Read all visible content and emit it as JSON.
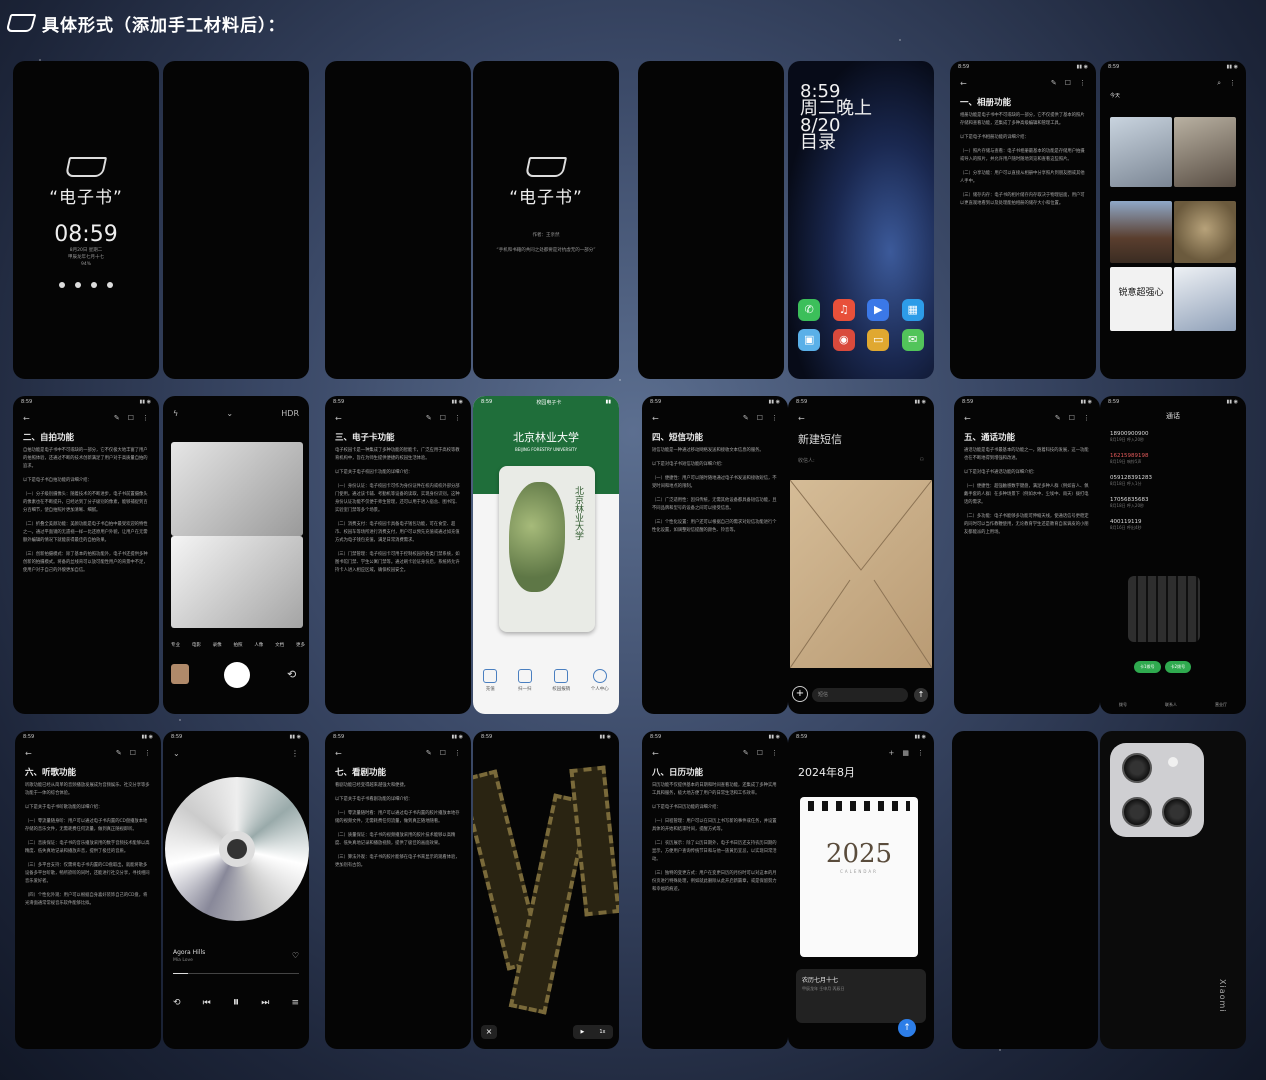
{
  "header": {
    "title": "具体形式（添加手工材料后）："
  },
  "lockscreen": {
    "cover_title": "“电子书”",
    "time": "08:59",
    "date_line1": "8月20日 星期二",
    "date_line2": "甲辰龙年七月十七",
    "battery": "94%"
  },
  "cover2": {
    "cover_title": "“电子书”",
    "author": "作者：王亲然",
    "quote": "“手机和书籍的共同之处都要是对抗虚无的一部分”"
  },
  "home": {
    "time_lines": [
      "8:59",
      "周二晚上",
      "8/20",
      "目录"
    ]
  },
  "status_time": "8:59",
  "album": {
    "title": "一、相册功能",
    "intro": "相册功能是电子书中不可或缺的一部分，它不仅提供了基本的照片存储和查看功能，还集成了多种高级编辑和管理工具。",
    "lead": "以下是电子书相册功能的详细介绍：",
    "p1": "（一）照片存储与查看：电子书相册最基本的功能是存储用户拍摄或导入的照片，并允许用户随时随地浏览和查看这些照片。",
    "p2": "（二）分享功能：用户可以直接从相册中分享照片到朋友圈或其他人手中。",
    "p3": "（三）储存内存：电子书的相片储存内存取决于物理层面，用户可以更直观地看到以及处理能拍相册的储存大小和位置。",
    "today": "今天",
    "sign_text": "锐意超强心"
  },
  "camera": {
    "title": "二、自拍功能",
    "intro": "自拍功能是电子书中不可或缺的一部分，它不仅极大地丰富了用户的拍照体验，还通过不断的技术创新满足了用户对于高质量自拍的追求。",
    "lead": "以下是电子书自拍功能的详细介绍：",
    "p1": "（一）分子级别摄像头：随着技术的不断进步，电子书前置摄像头的像素也在不断提升，已经达到了分子级别的像素，能够捕捉到百分百细节，使自拍照片更加清晰、细腻。",
    "p2": "（二）折叠全美颜功能：美颜功能是电子书自拍中最受欢迎的特性之一。通过平面镜的无遗视一样一比还原用户外貌，让用户在无需额外编辑的情况下就能获得最佳的自拍效果。",
    "p3": "（三）创新拍摄模式：除了基本的拍照功能外，电子书还提供多种创新的拍摄模式。将备的丝线背可以放可能性用户的背景中不足，使用户对于自己的外貌更加自信。",
    "hdr": "HDR",
    "modes": [
      "专业",
      "电影",
      "录像",
      "拍照",
      "人像",
      "文档",
      "更多"
    ]
  },
  "campus": {
    "title": "三、电子卡功能",
    "intro": "电子校园卡是一种集成了多种功能的智能卡，广泛应用于高校等教育机构中，旨在为师生提供便捷的校园生活体验。",
    "lead": "以下是关于电子校园卡功能的详细介绍：",
    "p1": "（一）身份认证：电子校园卡可作为身份证件在校内或校外部分部门使用。通过该卡辅、考勤机等设备的读取，实现身份识别。这种身份认证功能不仅便于师生管理，还可以用于进入宿舍、图书馆、实验室门禁等多个场景。",
    "p2": "（二）消费支付：电子校园卡具备电子钱包功能，可在食堂、超市、校园车等场所进行消费支付，用户可以预先充值或通过如充值方式为电子钱包充值，满足日常消费需求。",
    "p3": "（三）门禁管理：电子校园卡可用于控制校园内各类门禁系统，如图书馆门禁、学生公寓门禁等。通过刷卡验证身份后，系统将允许持卡人进入相应区域，确保校园安全。",
    "header_title": "校园电子卡",
    "university": "北京林业大学",
    "university_en": "BEIJING FORESTRY UNIVERSITY",
    "tabs": [
      "充值",
      "扫一扫",
      "校园报销",
      "个人中心"
    ]
  },
  "sms": {
    "title": "四、短信功能",
    "intro": "短信功能是一种通过移动网络发送和接收文本信息的服务。",
    "lead": "以下是对电子书短信功能的详细介绍：",
    "p1": "（一）便捷性：用户可以随时随地通过电子书发送和接收短信，不受时间和地点的限制。",
    "p2": "（二）广泛适用性：因归传统，无需其他设备都具备短信功能，且不同品牌和型号的设备之间可以接受信息。",
    "p3": "（三）个性化设置：用户还可以根据自己的需求对短信功能进行个性化设置，如调整短信提醒的颜色、铃音等。",
    "new_title": "新建短信",
    "to_placeholder": "收信人:",
    "sms_placeholder": "短信"
  },
  "call": {
    "title": "五、通话功能",
    "intro": "通话功能是电子书最基本的功能之一，随着科技的发展，这一功能也在不断地得到增强和改进。",
    "lead": "以下是对电子书通话功能的详细介绍：",
    "p1": "（一）便捷性：超强触感数字键盘，满足多种人群（例如盲人、佩戴手套的人群）在多种场景下（例如水中、尘埃中、雨天）拨打电话的需求。",
    "p2": "（二）多功能：电子书能够多功能可伸缩天线，使通话信号更稳定的同时可以当作教鞭使用，无论教育学生还是教育自家调皮的小朋友都能派的上用场。",
    "header": "通话",
    "log": [
      {
        "num": "18900900900",
        "sub": "8月19日 呼入20秒",
        "missed": false
      },
      {
        "num": "16215989198",
        "sub": "8月19日 响铃5声",
        "missed": true
      },
      {
        "num": "059128391283",
        "sub": "8月18日 呼入1分",
        "missed": false
      },
      {
        "num": "17056835683",
        "sub": "8月18日 呼入20秒",
        "missed": false
      },
      {
        "num": "400119119",
        "sub": "8月16日 呼出4秒",
        "missed": false
      }
    ],
    "btn1": "卡1拨号",
    "btn2": "卡2拨号",
    "nav": [
      "拨号",
      "联系人",
      "营业厅"
    ]
  },
  "music": {
    "title": "六、听歌功能",
    "intro": "听歌功能已经从简单的音频播放发展成为音频娱乐、社交分享等多功能于一体的综合体验。",
    "lead": "以下是关于电子书听歌功能的详细介绍：",
    "p1": "（一）零流量随身听：用户可以通过电子书内置的CD盘播放本地存储的音乐文件，无需耗费任何流量，做到真正随视即听。",
    "p2": "（二）音质保证：电子书的音乐播放采用的数字音频技术能够以高精度、低失真地记录和播放声音，提供了极佳的音质。",
    "p3": "（三）多平台支持：仅需将电子书内置的CD盘取出，就能将歌多设备多平台听歌，畅所欲听的同时，还能进行社交分享，寻找相同音乐爱好者。",
    "p4": "（四）个性化外观：用户可以根据自身喜好装饰自己的CD盘，将光滑面通常常规音乐软件能够比拟。",
    "song": "Agora Hills",
    "artist": "Mia Love"
  },
  "drama": {
    "title": "七、看剧功能",
    "intro": "看剧功能已经变得越来越强大和便捷。",
    "lead": "以下是关于电子书看剧功能的详细介绍：",
    "p1": "（一）零流量随时看：用户可以通过电子书内置的胶片播放本地存储的视频文件，无需耗费任何流量，做到真正随地随看。",
    "p2": "（二）质量保证：电子书的视频播放采用的胶片技术能够以高精度、低失真地记录和播放视频，提供了极佳的画面效果。",
    "p3": "（三）算法外观：电子书的胶片能够在电子书来显示的观看体验，更加别有古韵。",
    "speed": "1x"
  },
  "calendar": {
    "title": "八、日历功能",
    "intro": "日历功能不仅提供基本的日期和时间查看功能，还集成了多种实用工具和服务，极大地方便了用户的日常生活和工作效率。",
    "lead": "以下是电子书日历功能的详细介绍：",
    "p1": "（一）日程管理：用户可以在日历上书写新的事件或任务，并设置具体的开始和结束时间，提醒方式等。",
    "p2": "（二）农历展示：除了公历日期外，电子书日历还支持农历日期的显示，方便用户查询传统节日和与他一族黄历宜忌，以实现日常活动。",
    "p3": "（三）独特的变更方式：用户在变更日历的月份时可以对这本的月份页进行特殊处理，例如就此删除从此开启新篇章，或是保留努力和幸福的痕迹。",
    "month": "2024年8月",
    "year": "2025",
    "year_sub": "CALENDAR",
    "lunar": "农历七月十七",
    "lunar_sub": "甲辰龙年 壬申月 丙辰日"
  },
  "back": {
    "brand": "Xiaomi"
  }
}
